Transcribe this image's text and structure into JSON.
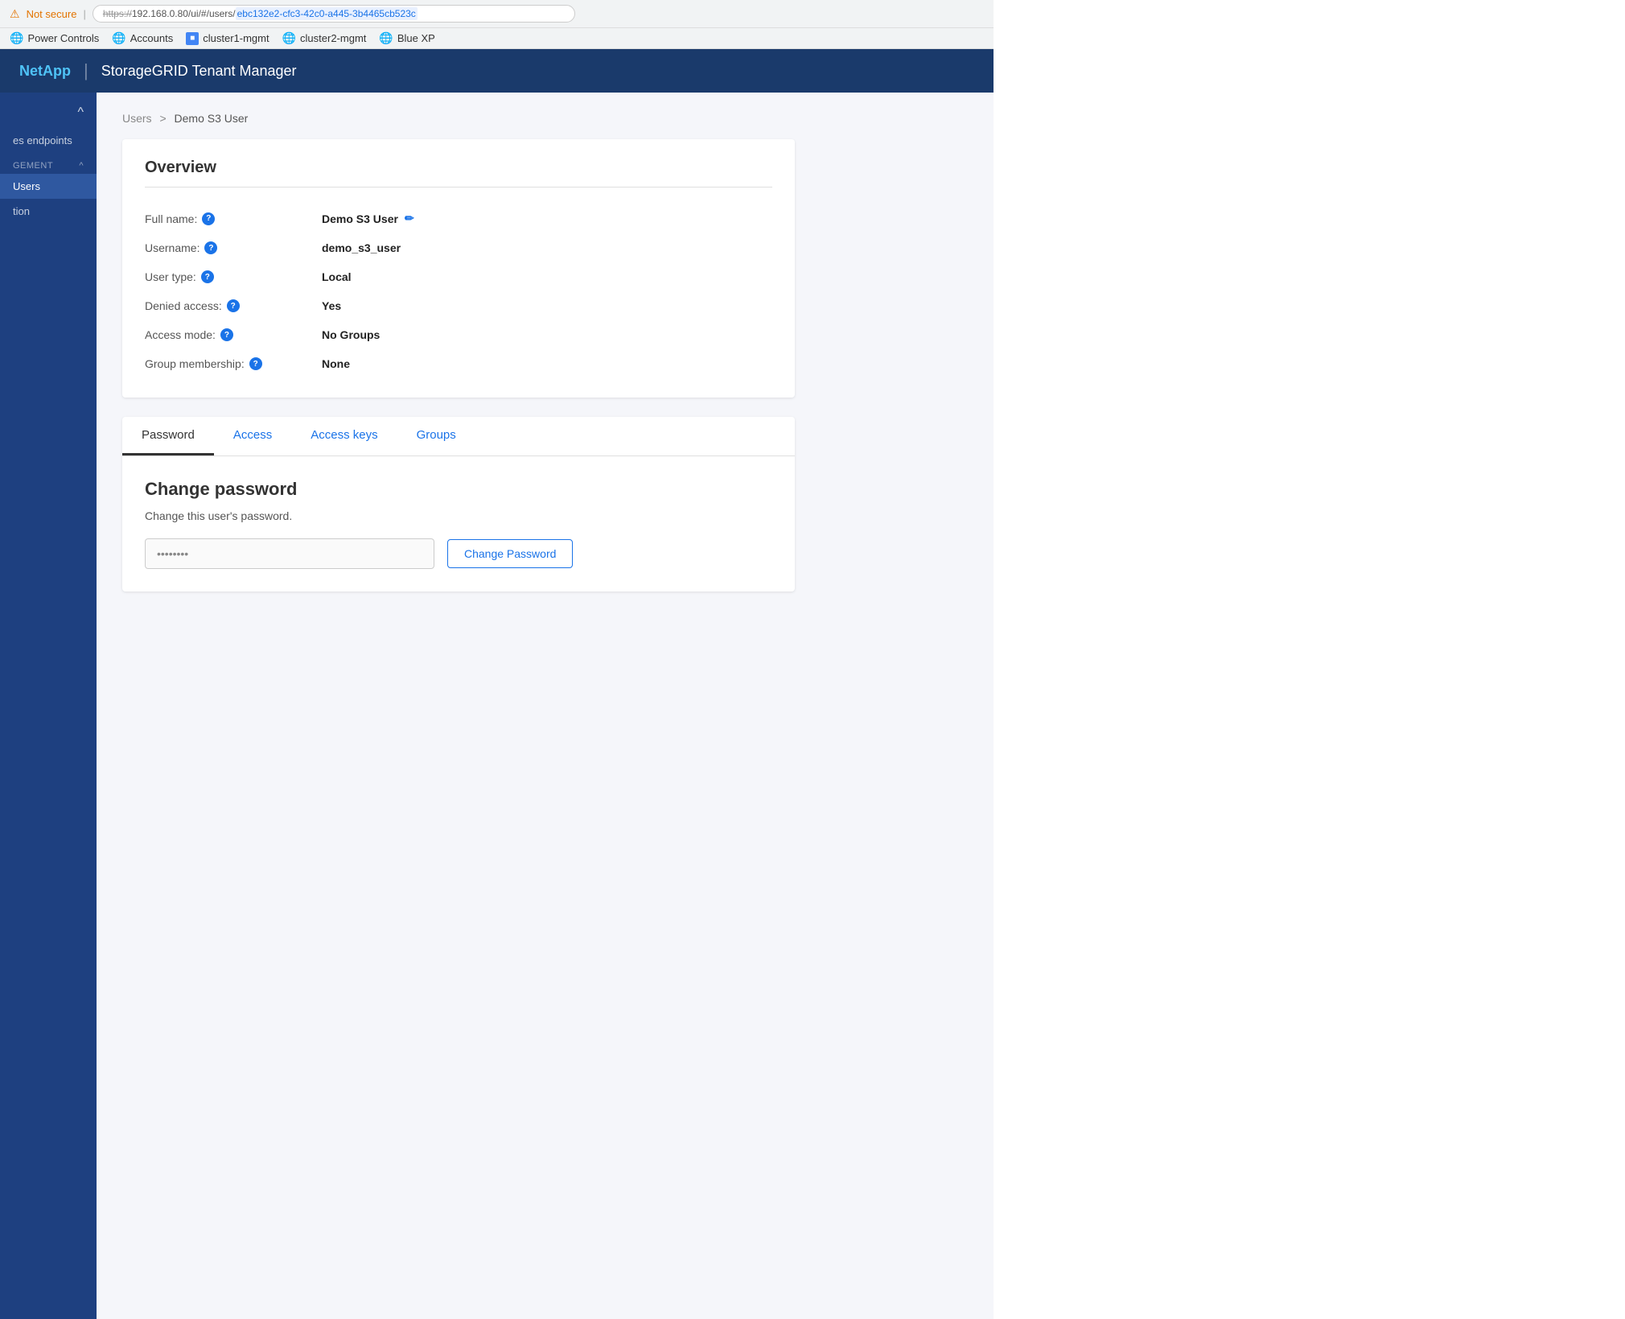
{
  "browser": {
    "security_icon": "⚠",
    "not_secure_label": "Not secure",
    "url_prefix": "https://",
    "url_domain": "192.168.0.80/ui/#/users/",
    "url_path": "ebc132e2-cfc3-42c0-a445-3b4465cb523c"
  },
  "bookmarks": [
    {
      "id": "power-controls",
      "icon": "globe",
      "label": "Power Controls"
    },
    {
      "id": "accounts",
      "icon": "globe",
      "label": "Accounts"
    },
    {
      "id": "cluster1-mgmt",
      "icon": "square",
      "label": "cluster1-mgmt"
    },
    {
      "id": "cluster2-mgmt",
      "icon": "globe",
      "label": "cluster2-mgmt"
    },
    {
      "id": "blue-xp",
      "icon": "globe",
      "label": "Blue XP"
    }
  ],
  "header": {
    "logo": "NetApp",
    "divider": "|",
    "title": "StorageGRID Tenant Manager"
  },
  "sidebar": {
    "collapse_label": "^",
    "items": [
      {
        "id": "platform-services",
        "label": "es endpoints",
        "active": false
      },
      {
        "id": "management-section",
        "label": "GEMENT",
        "is_section": true
      },
      {
        "id": "users",
        "label": "Users",
        "active": true
      },
      {
        "id": "tion",
        "label": "tion",
        "active": false
      }
    ]
  },
  "breadcrumb": {
    "parent_label": "Users",
    "separator": ">",
    "current_label": "Demo S3 User"
  },
  "overview": {
    "title": "Overview",
    "fields": [
      {
        "label": "Full name:",
        "value": "Demo S3 User",
        "has_help": true,
        "has_edit": true
      },
      {
        "label": "Username:",
        "value": "demo_s3_user",
        "has_help": true,
        "has_edit": false
      },
      {
        "label": "User type:",
        "value": "Local",
        "has_help": true,
        "has_edit": false
      },
      {
        "label": "Denied access:",
        "value": "Yes",
        "has_help": true,
        "has_edit": false
      },
      {
        "label": "Access mode:",
        "value": "No Groups",
        "has_help": true,
        "has_edit": false
      },
      {
        "label": "Group membership:",
        "value": "None",
        "has_help": true,
        "has_edit": false
      }
    ]
  },
  "tabs": {
    "items": [
      {
        "id": "password",
        "label": "Password",
        "active": true
      },
      {
        "id": "access",
        "label": "Access",
        "active": false
      },
      {
        "id": "access-keys",
        "label": "Access keys",
        "active": false
      },
      {
        "id": "groups",
        "label": "Groups",
        "active": false
      }
    ]
  },
  "password_tab": {
    "title": "Change password",
    "description": "Change this user's password.",
    "input_placeholder": "••••••••",
    "button_label": "Change Password"
  }
}
